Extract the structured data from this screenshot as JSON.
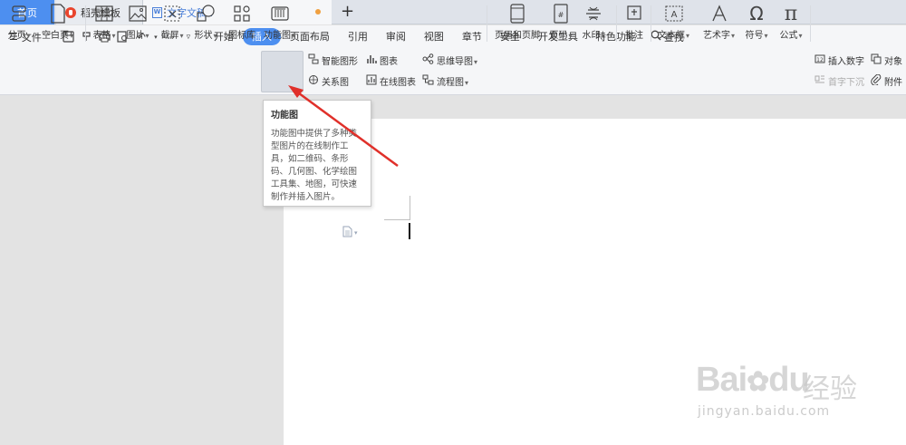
{
  "tabs": {
    "home": "首页",
    "templates": "稻壳模板",
    "document": "文字文稿1",
    "add": "+"
  },
  "menubar": {
    "file": "文件",
    "items": [
      "开始",
      "插入",
      "页面布局",
      "引用",
      "审阅",
      "视图",
      "章节",
      "安全",
      "开发工具",
      "特色功能"
    ],
    "active_index": 1,
    "search": "查找"
  },
  "ribbon": {
    "page_break": "分页",
    "blank_page": "空白页",
    "table": "表格",
    "picture": "图片",
    "screenshot": "截屏",
    "shape": "形状",
    "icon_library": "图标库",
    "function_chart": "功能图",
    "smart_graphic": "智能图形",
    "chart": "图表",
    "relation_chart": "关系图",
    "online_chart": "在线图表",
    "mind_map": "思维导图",
    "flowchart": "流程图",
    "header_footer": "页眉和页脚",
    "page_number": "页码",
    "watermark": "水印",
    "comment": "批注",
    "text_box": "文本框",
    "word_art": "艺术字",
    "symbol": "符号",
    "formula": "公式",
    "insert_number": "插入数字",
    "object": "对象",
    "drop_cap": "首字下沉",
    "attachment": "附件"
  },
  "tooltip": {
    "title": "功能图",
    "body": "功能图中提供了多种类型图片的在线制作工具，如二维码、条形码、几何图、化学绘图工具集、地图，可快速制作并插入图片。"
  },
  "watermark": {
    "brand": "Bai",
    "brand2": "du",
    "cn": "经验",
    "url": "jingyan.baidu.com"
  },
  "colors": {
    "accent": "#4d8ff0",
    "arrow": "#e0302a"
  }
}
